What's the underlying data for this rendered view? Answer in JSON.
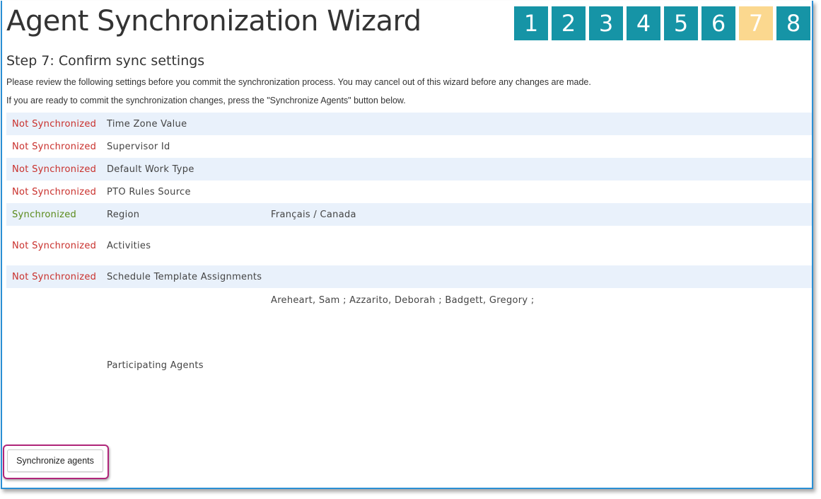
{
  "header": {
    "title": "Agent Synchronization Wizard",
    "steps": [
      "1",
      "2",
      "3",
      "4",
      "5",
      "6",
      "7",
      "8"
    ],
    "active_step": "7",
    "colors": {
      "step": "#1694a6",
      "active_step": "#fbd88f"
    }
  },
  "step": {
    "title": "Step 7: Confirm sync settings",
    "intro_1": "Please review the following settings before you commit the synchronization process. You may cancel out of this wizard before any changes are made.",
    "intro_2": "If you are ready to commit the synchronization changes, press the \"Synchronize Agents\" button below."
  },
  "settings": [
    {
      "status": "Not Synchronized",
      "setting": "Time Zone Value",
      "value": ""
    },
    {
      "status": "Not Synchronized",
      "setting": "Supervisor Id",
      "value": ""
    },
    {
      "status": "Not Synchronized",
      "setting": "Default Work Type",
      "value": ""
    },
    {
      "status": "Not Synchronized",
      "setting": "PTO Rules Source",
      "value": ""
    },
    {
      "status": "Synchronized",
      "setting": "Region",
      "value": "Français / Canada"
    },
    {
      "status": "Not Synchronized",
      "setting": "Activities",
      "value": ""
    },
    {
      "status": "Not Synchronized",
      "setting": "Schedule Template Assignments",
      "value": ""
    }
  ],
  "agents": {
    "label": "Participating Agents",
    "list": "Areheart, Sam ; Azzarito, Deborah ; Badgett, Gregory ;"
  },
  "actions": {
    "synchronize_label": "Synchronize agents"
  },
  "status_colors": {
    "not_synchronized": "#c9302c",
    "synchronized": "#5a8a1a"
  }
}
